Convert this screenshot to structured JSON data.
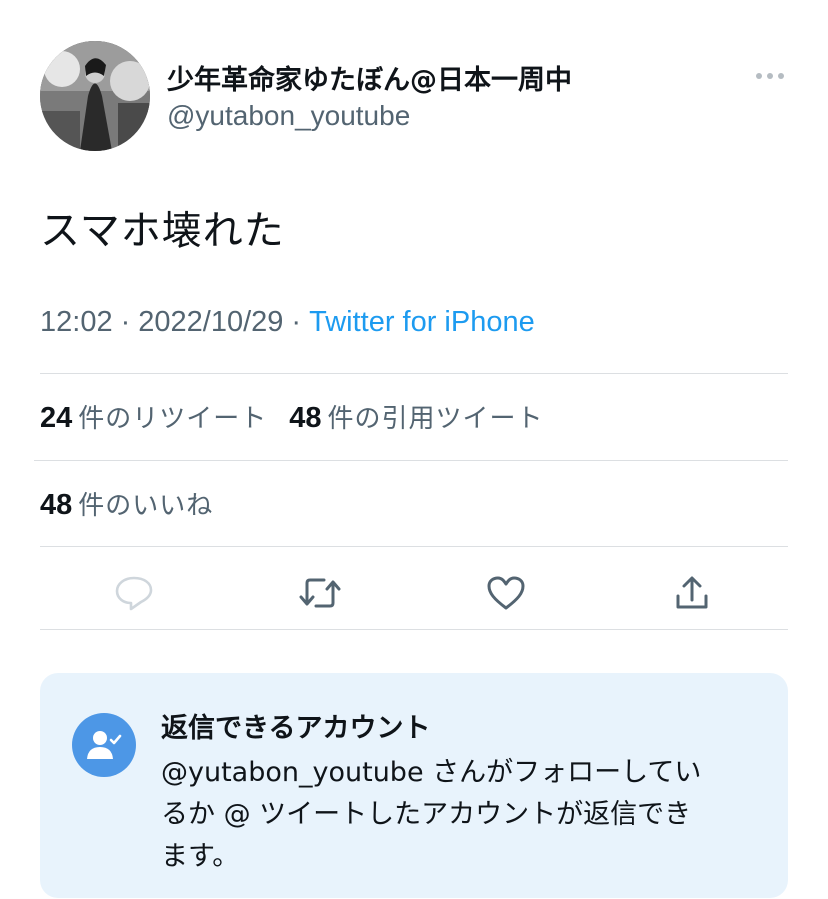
{
  "author": {
    "display_name": "少年革命家ゆたぼん@日本一周中",
    "handle": "@yutabon_youtube"
  },
  "tweet": {
    "text": "スマホ壊れた"
  },
  "meta": {
    "time": "12:02",
    "date": "2022/10/29",
    "separator": "·",
    "source": "Twitter for iPhone"
  },
  "stats": {
    "retweets": {
      "count": "24",
      "label": "件のリツイート"
    },
    "quotes": {
      "count": "48",
      "label": "件の引用ツイート"
    },
    "likes": {
      "count": "48",
      "label": "件のいいね"
    }
  },
  "actions": [
    "reply-icon",
    "retweet-icon",
    "like-icon",
    "share-icon"
  ],
  "reply_card": {
    "title": "返信できるアカウント",
    "line1": "@yutabon_youtube さんがフォローしてい",
    "line2": "るか @ ツイートしたアカウントが返信でき",
    "line3": "ます。"
  },
  "colors": {
    "link": "#1d9bf0",
    "secondary_text": "#536471",
    "card_bg": "#e8f3fc",
    "card_icon_bg": "#4d97e6"
  }
}
